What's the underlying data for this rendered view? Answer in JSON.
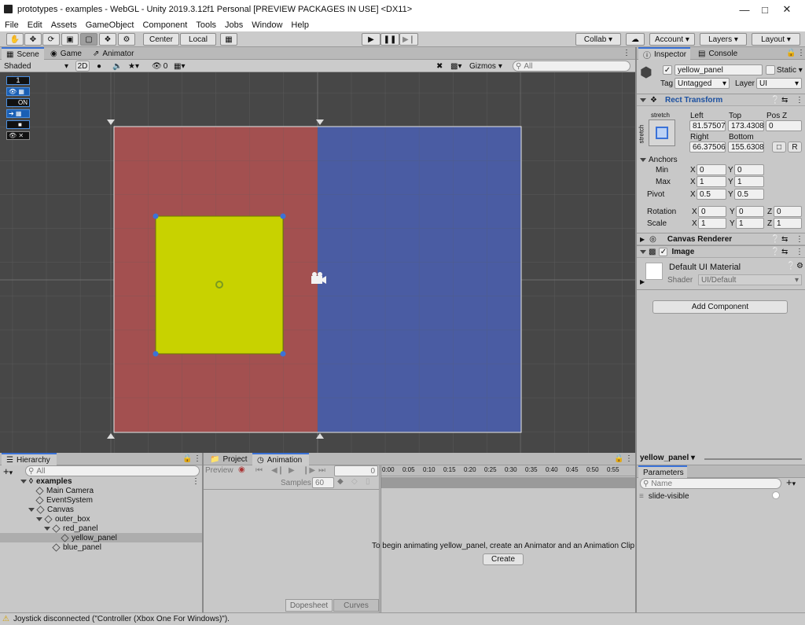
{
  "window": {
    "title": "prototypes - examples - WebGL - Unity 2019.3.12f1 Personal [PREVIEW PACKAGES IN USE] <DX11>"
  },
  "menu": [
    "File",
    "Edit",
    "Assets",
    "GameObject",
    "Component",
    "Tools",
    "Jobs",
    "Window",
    "Help"
  ],
  "toolbar": {
    "center_label": "Center",
    "local_label": "Local",
    "collab_label": "Collab",
    "account_label": "Account",
    "layers_label": "Layers",
    "layout_label": "Layout"
  },
  "scene_tabs": {
    "scene": "Scene",
    "game": "Game",
    "animator": "Animator"
  },
  "scene_bar": {
    "shading": "Shaded",
    "mode_2d": "2D",
    "fx_count": "0",
    "gizmos": "Gizmos",
    "search_placeholder": "All"
  },
  "overlay": {
    "layer_index": "1",
    "on_label": "ON"
  },
  "colors": {
    "red_panel": "#a35050",
    "blue_panel": "#4a5ca3",
    "yellow_panel": "#c8d200",
    "scene_bg": "#474747",
    "accent": "#3a72d8"
  },
  "inspector": {
    "tabs": {
      "inspector": "Inspector",
      "console": "Console"
    },
    "object_name": "yellow_panel",
    "static_label": "Static",
    "tag_label": "Tag",
    "tag_value": "Untagged",
    "layer_label": "Layer",
    "layer_value": "UI",
    "rect_transform": {
      "title": "Rect Transform",
      "stretch_top": "stretch",
      "stretch_side": "stretch",
      "left_label": "Left",
      "left": "81.57507",
      "top_label": "Top",
      "top": "173.4308",
      "posz_label": "Pos Z",
      "posz": "0",
      "right_label": "Right",
      "right": "66.37506",
      "bottom_label": "Bottom",
      "bottom": "155.6308",
      "r_label": "R",
      "anchors_label": "Anchors",
      "min_label": "Min",
      "min_x": "0",
      "min_y": "0",
      "max_label": "Max",
      "max_x": "1",
      "max_y": "1",
      "pivot_label": "Pivot",
      "pivot_x": "0.5",
      "pivot_y": "0.5",
      "rotation_label": "Rotation",
      "rot_x": "0",
      "rot_y": "0",
      "rot_z": "0",
      "scale_label": "Scale",
      "scale_x": "1",
      "scale_y": "1",
      "scale_z": "1",
      "x": "X",
      "y": "Y",
      "z": "Z"
    },
    "canvas_renderer": "Canvas Renderer",
    "image": "Image",
    "material_name": "Default UI Material",
    "shader_label": "Shader",
    "shader_value": "UI/Default",
    "add_component": "Add Component"
  },
  "hierarchy": {
    "tab": "Hierarchy",
    "search_placeholder": "All",
    "scene_name": "examples",
    "items": [
      "Main Camera",
      "EventSystem",
      "Canvas",
      "outer_box",
      "red_panel",
      "yellow_panel",
      "blue_panel"
    ]
  },
  "animation": {
    "tabs": {
      "project": "Project",
      "animation": "Animation"
    },
    "preview": "Preview",
    "frame": "0",
    "samples_label": "Samples",
    "samples": "60",
    "ticks": [
      "0:00",
      "0:05",
      "0:10",
      "0:15",
      "0:20",
      "0:25",
      "0:30",
      "0:35",
      "0:40",
      "0:45",
      "0:50",
      "0:55"
    ],
    "message": "To begin animating yellow_panel, create an Animator and an Animation Clip",
    "create": "Create",
    "dopesheet": "Dopesheet",
    "curves": "Curves"
  },
  "animator_panel": {
    "selected": "yellow_panel",
    "parameters_tab": "Parameters",
    "search_placeholder": "Name",
    "params": [
      "slide-visible"
    ]
  },
  "status": {
    "message": "Joystick disconnected (\"Controller (Xbox One For Windows)\")."
  }
}
